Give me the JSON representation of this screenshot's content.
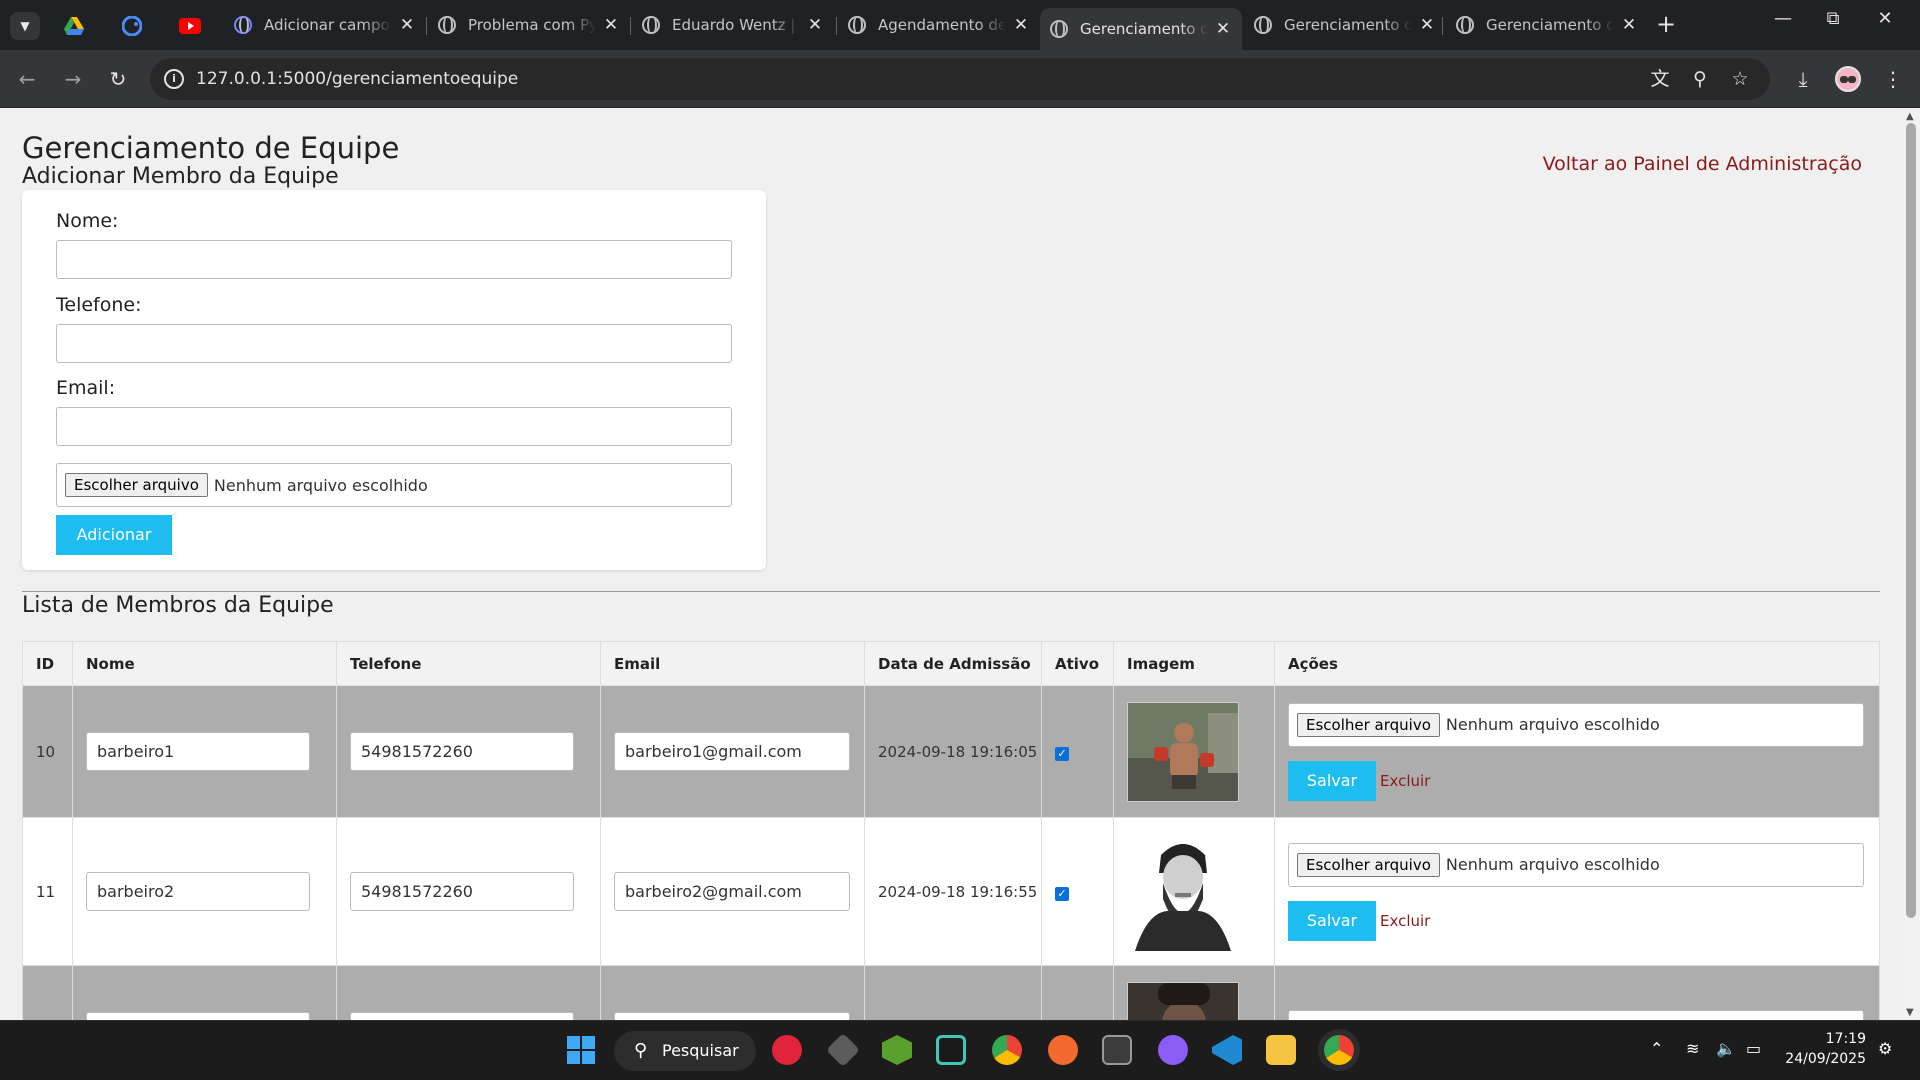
{
  "browser": {
    "tabs": [
      {
        "title": "Adicionar campo"
      },
      {
        "title": "Problema com Py"
      },
      {
        "title": "Eduardo Wentz |"
      },
      {
        "title": "Agendamento de"
      },
      {
        "title": "Gerenciamento d"
      },
      {
        "title": "Gerenciamento d"
      },
      {
        "title": "Gerenciamento d"
      }
    ],
    "active_tab_index": 4,
    "url": "127.0.0.1:5000/gerenciamentoequipe"
  },
  "page": {
    "title": "Gerenciamento de Equipe",
    "add_section_title": "Adicionar Membro da Equipe",
    "back_link": "Voltar ao Painel de Administração",
    "form": {
      "name_label": "Nome:",
      "phone_label": "Telefone:",
      "email_label": "Email:",
      "file_button": "Escolher arquivo",
      "file_status": "Nenhum arquivo escolhido",
      "submit": "Adicionar"
    },
    "list_title": "Lista de Membros da Equipe",
    "table": {
      "headers": [
        "ID",
        "Nome",
        "Telefone",
        "Email",
        "Data de Admissão",
        "Ativo",
        "Imagem",
        "Ações"
      ],
      "rows": [
        {
          "id": "10",
          "name": "barbeiro1",
          "phone": "54981572260",
          "email": "barbeiro1@gmail.com",
          "admission": "2024-09-18 19:16:05",
          "active": true
        },
        {
          "id": "11",
          "name": "barbeiro2",
          "phone": "54981572260",
          "email": "barbeiro2@gmail.com",
          "admission": "2024-09-18 19:16:55",
          "active": true
        }
      ],
      "file_button": "Escolher arquivo",
      "file_status": "Nenhum arquivo escolhido",
      "save": "Salvar",
      "delete": "Excluir"
    }
  },
  "taskbar": {
    "search": "Pesquisar",
    "time": "17:19",
    "date": "24/09/2025"
  },
  "colors": {
    "accent": "#1ebdf0",
    "link": "#8b1a1a",
    "alt_row": "#adadad"
  }
}
